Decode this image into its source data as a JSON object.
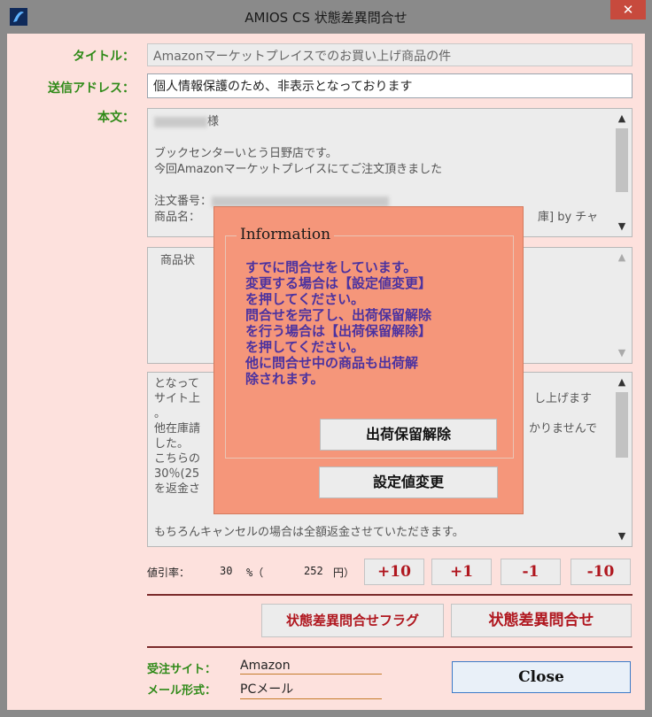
{
  "window": {
    "title": "AMIOS CS 状態差異問合せ",
    "close_glyph": "✕"
  },
  "form": {
    "title_label": "タイトル：",
    "title_value": "Amazonマーケットプレイスでのお買い上げ商品の件",
    "address_label": "送信アドレス：",
    "address_value": "個人情報保護のため、非表示となっております",
    "body_label": "本文："
  },
  "body_area": {
    "line_sama": "様",
    "line1": "ブックセンターいとう日野店です。",
    "line2": "今回Amazonマーケットプレイスにてご注文頂きました",
    "order_prefix": "注文番号：",
    "product_prefix": "商品名：",
    "product_suffix": "庫] by チャ"
  },
  "middle_area": {
    "text": "商品状"
  },
  "bottom_area": {
    "line1_left": "となって",
    "line2_left": "サイト上",
    "line2_right": "し上げます",
    "line3": "。",
    "line4_left": "他在庫請",
    "line4_right": "かりませんで",
    "line5": "した。",
    "line6": "こちらの",
    "line7": "30％(25",
    "line8": "を返金さ",
    "last_line": "もちろんキャンセルの場合は全額返金させていただきます。"
  },
  "discount": {
    "label": "値引率：",
    "percent": "30",
    "percent_unit": "%（",
    "yen": "252",
    "yen_unit": "円）",
    "buttons": [
      "+10",
      "+1",
      "-1",
      "-10"
    ]
  },
  "actions": {
    "flag_label": "状態差異問合せフラグ",
    "inquiry_label": "状態差異問合せ"
  },
  "footer": {
    "site_label": "受注サイト：",
    "site_value": "Amazon",
    "mail_label": "メール形式：",
    "mail_value": "PCメール",
    "close_label": "Close"
  },
  "dialog": {
    "group_title": "Information",
    "message_lines": [
      "すでに問合せをしています。",
      "変更する場合は【設定値変更】",
      "を押してください。",
      "問合せを完了し、出荷保留解除",
      "を行う場合は【出荷保留解除】",
      "を押してください。",
      "他に問合せ中の商品も出荷解",
      "除されます。"
    ],
    "release_button": "出荷保留解除",
    "change_button": "設定値変更"
  }
}
